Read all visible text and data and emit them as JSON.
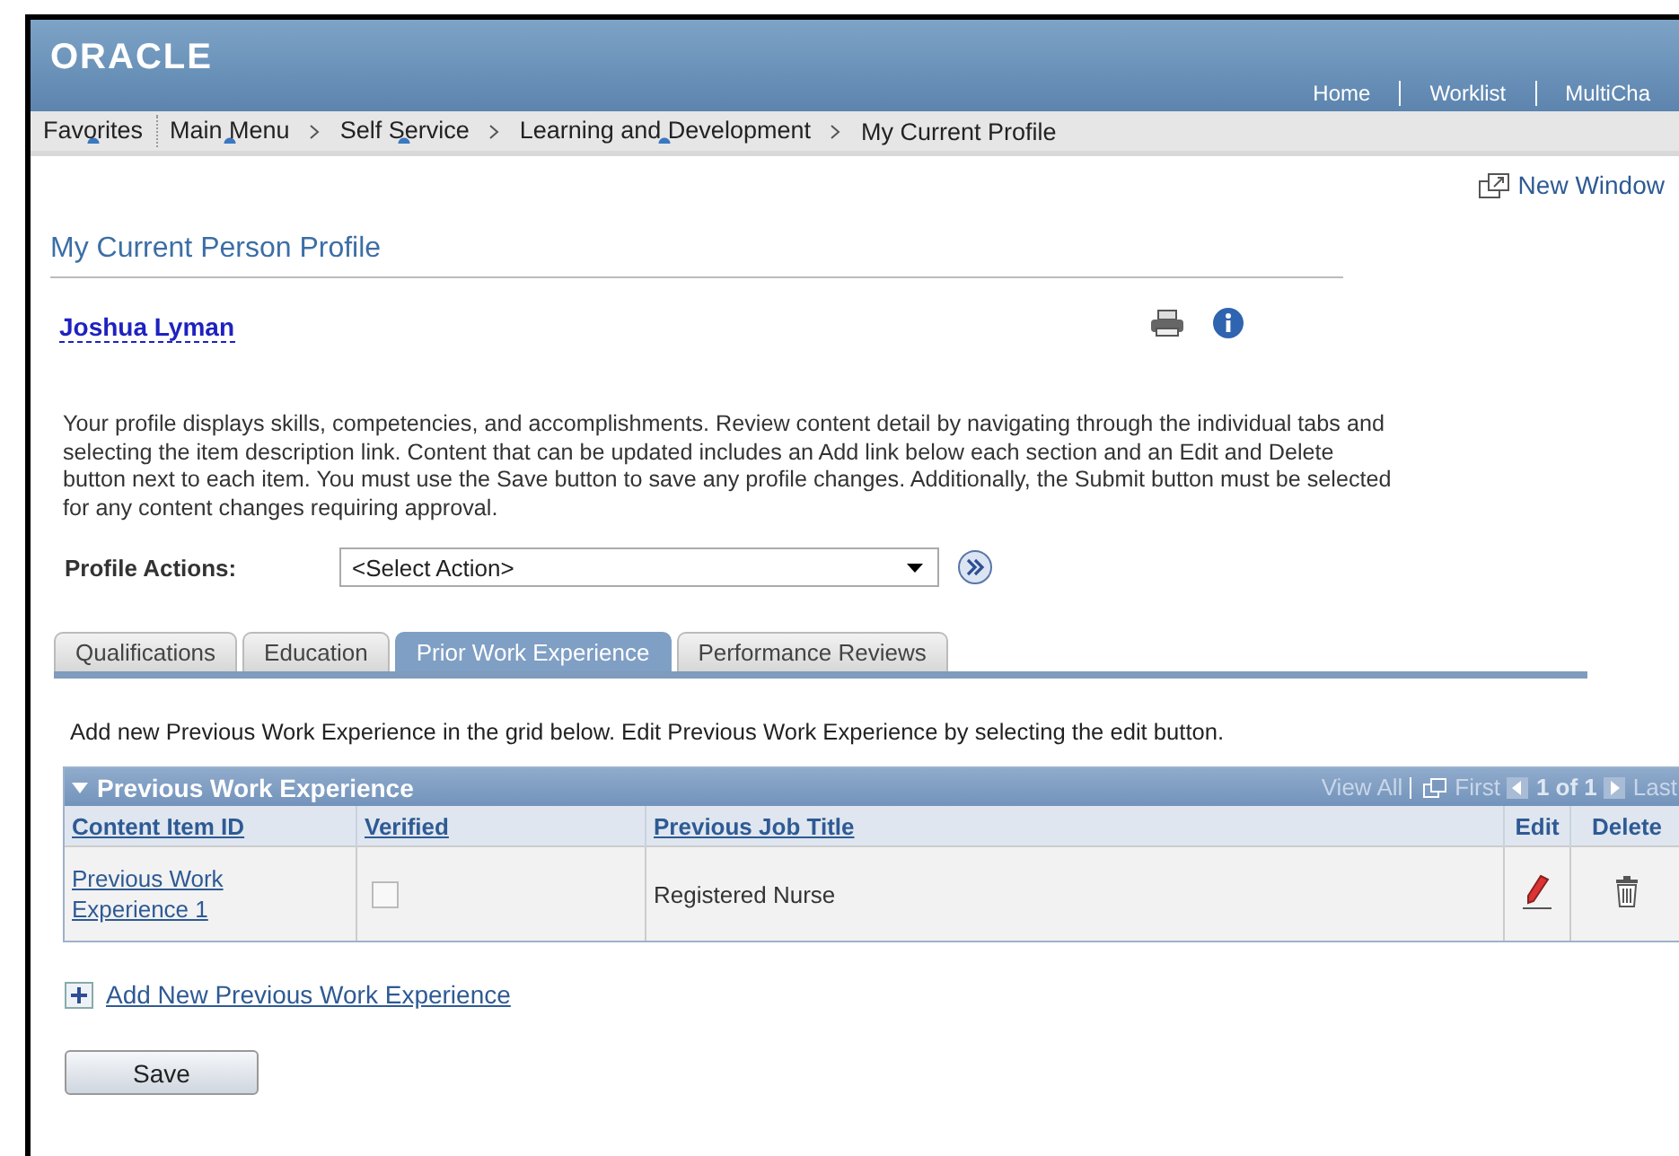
{
  "header": {
    "logo": "ORACLE",
    "links": [
      "Home",
      "Worklist",
      "MultiCha"
    ]
  },
  "nav": [
    {
      "label": "Favorites",
      "menu": true
    },
    {
      "label": "Main Menu",
      "menu": true
    },
    {
      "label": "Self Service",
      "menu": true
    },
    {
      "label": "Learning and Development",
      "menu": true
    },
    {
      "label": "My Current Profile",
      "menu": false
    }
  ],
  "new_window": "New Window",
  "page_title": "My Current Person Profile",
  "person": "Joshua Lyman",
  "intro": "Your profile displays skills, competencies, and accomplishments. Review content detail by navigating through the individual tabs and selecting the item description link. Content that can be updated includes an Add link below each section and an Edit and Delete button next to each item. You must use the Save button to save any profile changes. Additionally, the Submit button must be selected for any content changes requiring approval.",
  "profile_actions": {
    "label": "Profile Actions:",
    "value": "<Select Action>"
  },
  "tabs": [
    {
      "label": "Qualifications",
      "selected": false
    },
    {
      "label": "Education",
      "selected": false
    },
    {
      "label": "Prior Work Experience",
      "selected": true
    },
    {
      "label": "Performance Reviews",
      "selected": false
    }
  ],
  "instruction": "Add new Previous Work Experience in the grid below. Edit Previous Work Experience by selecting the edit button.",
  "grid": {
    "title": "Previous Work Experience",
    "view_all": "View All",
    "first": "First",
    "page": "1 of 1",
    "last": "Last",
    "columns": [
      "Content Item ID",
      "Verified",
      "Previous Job Title",
      "Edit",
      "Delete"
    ],
    "rows": [
      {
        "item": "Previous Work Experience 1",
        "verified": false,
        "job_title": "Registered Nurse"
      }
    ]
  },
  "add_link": "Add New Previous Work Experience",
  "save": "Save"
}
